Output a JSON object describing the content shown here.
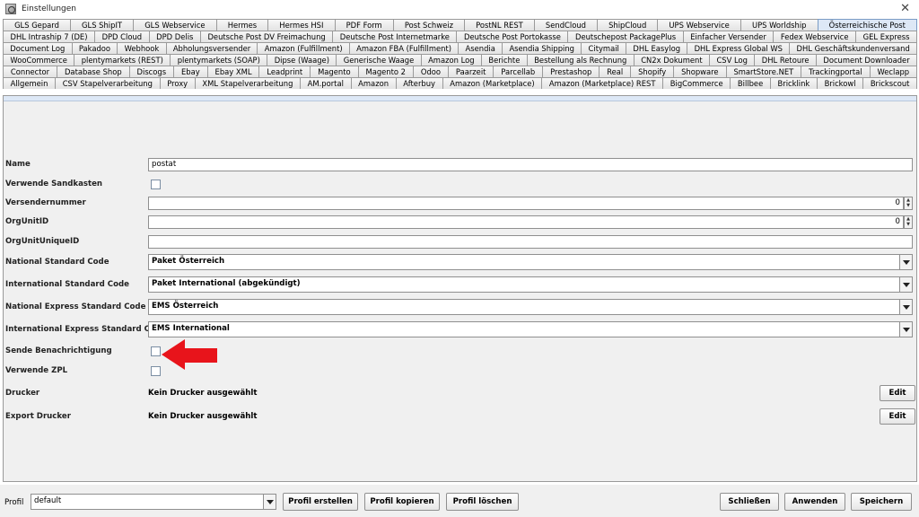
{
  "window": {
    "title": "Einstellungen",
    "close_glyph": "✕"
  },
  "tabs": {
    "rows": [
      [
        "GLS Gepard",
        "GLS ShipIT",
        "GLS Webservice",
        "Hermes",
        "Hermes HSI",
        "PDF Form",
        "Post Schweiz",
        "PostNL REST",
        "SendCloud",
        "ShipCloud",
        "UPS Webservice",
        "UPS Worldship",
        "Österreichische Post"
      ],
      [
        "DHL Intraship 7 (DE)",
        "DPD Cloud",
        "DPD Delis",
        "Deutsche Post DV Freimachung",
        "Deutsche Post Internetmarke",
        "Deutsche Post Portokasse",
        "Deutschepost PackagePlus",
        "Einfacher Versender",
        "Fedex Webservice",
        "GEL Express"
      ],
      [
        "Document Log",
        "Pakadoo",
        "Webhook",
        "Abholungsversender",
        "Amazon (Fulfillment)",
        "Amazon FBA (Fulfillment)",
        "Asendia",
        "Asendia Shipping",
        "Citymail",
        "DHL Easylog",
        "DHL Express Global WS",
        "DHL Geschäftskundenversand"
      ],
      [
        "WooCommerce",
        "plentymarkets (REST)",
        "plentymarkets (SOAP)",
        "Dipse (Waage)",
        "Generische Waage",
        "Amazon Log",
        "Berichte",
        "Bestellung als Rechnung",
        "CN2x Dokument",
        "CSV Log",
        "DHL Retoure",
        "Document Downloader"
      ],
      [
        "Connector",
        "Database Shop",
        "Discogs",
        "Ebay",
        "Ebay XML",
        "Leadprint",
        "Magento",
        "Magento 2",
        "Odoo",
        "Paarzeit",
        "Parcellab",
        "Prestashop",
        "Real",
        "Shopify",
        "Shopware",
        "SmartStore.NET",
        "Trackingportal",
        "Weclapp"
      ],
      [
        "Allgemein",
        "CSV Stapelverarbeitung",
        "Proxy",
        "XML Stapelverarbeitung",
        "AM.portal",
        "Amazon",
        "Afterbuy",
        "Amazon (Marketplace)",
        "Amazon (Marketplace) REST",
        "BigCommerce",
        "Billbee",
        "Bricklink",
        "Brickowl",
        "Brickscout"
      ]
    ],
    "active": "Österreichische Post"
  },
  "form": {
    "name": {
      "label": "Name",
      "value": "postat"
    },
    "sandbox": {
      "label": "Verwende Sandkasten"
    },
    "sender_number": {
      "label": "Versendernummer",
      "value": "0"
    },
    "org_unit_id": {
      "label": "OrgUnitID",
      "value": "0"
    },
    "org_unit_unique_id": {
      "label": "OrgUnitUniqueID",
      "value": ""
    },
    "national_standard": {
      "label": "National Standard Code",
      "value": "Paket Österreich"
    },
    "international_standard": {
      "label": "International Standard Code",
      "value": "Paket International (abgekündigt)"
    },
    "national_express": {
      "label": "National Express Standard Code",
      "value": "EMS Österreich"
    },
    "international_express": {
      "label": "International Express Standard Code",
      "value": "EMS International"
    },
    "send_notification": {
      "label": "Sende Benachrichtigung"
    },
    "use_zpl": {
      "label": "Verwende ZPL"
    },
    "printer": {
      "label": "Drucker",
      "value": "Kein Drucker ausgewählt",
      "button": "Edit"
    },
    "export_printer": {
      "label": "Export Drucker",
      "value": "Kein Drucker ausgewählt",
      "button": "Edit"
    }
  },
  "annotation": {
    "icon": "red-arrow-icon",
    "color": "#e8141b"
  },
  "bottom": {
    "profile_label": "Profil",
    "profile_value": "default",
    "create": "Profil erstellen",
    "copy": "Profil kopieren",
    "delete": "Profil löschen",
    "close": "Schließen",
    "apply": "Anwenden",
    "save": "Speichern"
  }
}
